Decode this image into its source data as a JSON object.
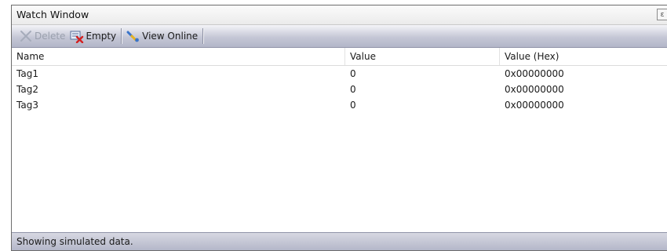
{
  "window": {
    "title": "Watch Window",
    "close_glyph": "ε"
  },
  "toolbar": {
    "delete_label": "Delete",
    "empty_label": "Empty",
    "view_online_label": "View Online"
  },
  "grid": {
    "headers": [
      "Name",
      "Value",
      "Value (Hex)"
    ],
    "rows": [
      {
        "name": "Tag1",
        "value": "0",
        "hex": "0x00000000"
      },
      {
        "name": "Tag2",
        "value": "0",
        "hex": "0x00000000"
      },
      {
        "name": "Tag3",
        "value": "0",
        "hex": "0x00000000"
      }
    ]
  },
  "status": {
    "text": "Showing simulated data."
  },
  "icons": {
    "delete": "delete-x-icon",
    "empty": "empty-clear-icon",
    "view_online": "view-online-icon"
  }
}
